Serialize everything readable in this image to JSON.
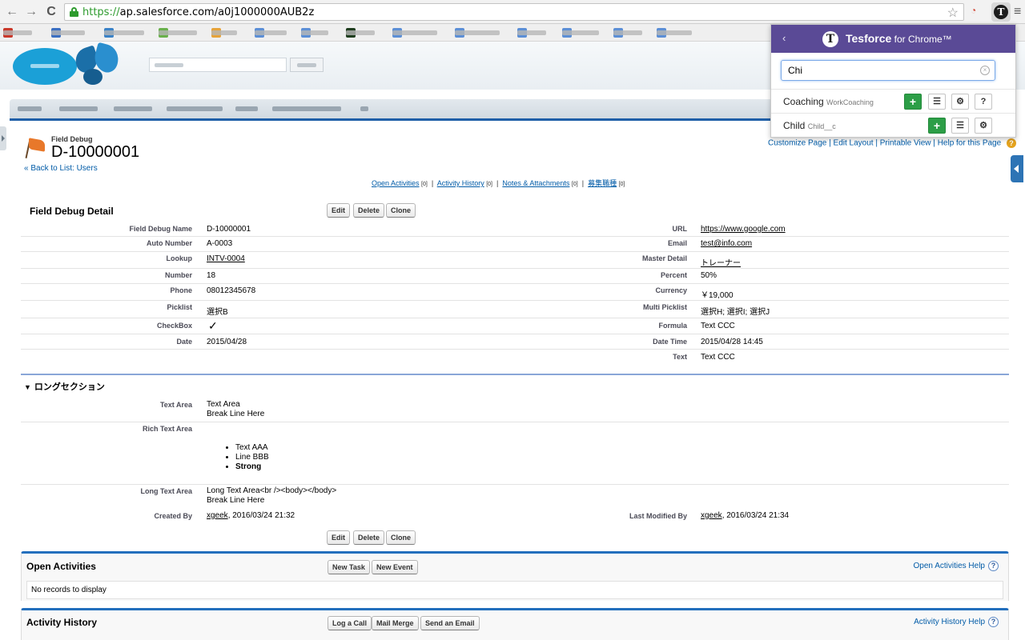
{
  "browser": {
    "url_scheme": "https://",
    "url_rest": "ap.salesforce.com/a0j1000000AUB2z",
    "back": "←",
    "forward": "→",
    "reload": "C",
    "star": "☆",
    "menu": "≡",
    "tesforce_letter": "T"
  },
  "record": {
    "type_label": "Field Debug",
    "name": "D-10000001",
    "back_link": "« Back to List: Users",
    "top_links": [
      "Customize Page",
      "Edit Layout",
      "Printable View",
      "Help for this Page"
    ],
    "help_q": "?"
  },
  "related_links": [
    {
      "label": "Open Activities",
      "count": "[0]"
    },
    {
      "label": "Activity History",
      "count": "[0]"
    },
    {
      "label": "Notes & Attachments",
      "count": "[0]"
    },
    {
      "label": "募集職種",
      "count": "[0]"
    }
  ],
  "detail": {
    "title": "Field Debug Detail",
    "buttons": {
      "edit": "Edit",
      "delete": "Delete",
      "clone": "Clone"
    },
    "left_fields": [
      {
        "label": "Field Debug Name",
        "value": "D-10000001"
      },
      {
        "label": "Auto Number",
        "value": "A-0003"
      },
      {
        "label": "Lookup",
        "value": "INTV-0004"
      },
      {
        "label": "Number",
        "value": "18"
      },
      {
        "label": "Phone",
        "value": "08012345678"
      },
      {
        "label": "Picklist",
        "value": "選択B"
      },
      {
        "label": "CheckBox",
        "value": "✓"
      },
      {
        "label": "Date",
        "value": "2015/04/28"
      }
    ],
    "right_fields": [
      {
        "label": "URL",
        "value": "https://www.google.com"
      },
      {
        "label": "Email",
        "value": "test@info.com"
      },
      {
        "label": "Master Detail",
        "value": "トレーナー"
      },
      {
        "label": "Percent",
        "value": "50%"
      },
      {
        "label": "Currency",
        "value": "￥19,000"
      },
      {
        "label": "Multi Picklist",
        "value": "選択H; 選択I; 選択J"
      },
      {
        "label": "Formula",
        "value": "Text CCC"
      },
      {
        "label": "Date Time",
        "value": "2015/04/28 14:45"
      },
      {
        "label": "Text",
        "value": "Text CCC"
      }
    ]
  },
  "long_section": {
    "title": "ロングセクション",
    "text_area_label": "Text Area",
    "text_area_lines": [
      "Text Area",
      "Break Line Here"
    ],
    "rich_text_label": "Rich Text Area",
    "rich_items": [
      "Text AAA",
      "Line BBB",
      "Strong"
    ],
    "long_text_label": "Long Text Area",
    "long_text_lines": [
      "Long Text Area<br /><body></body>",
      "Break Line Here"
    ],
    "created_by_label": "Created By",
    "created_by_user": "xgeek",
    "created_by_date": ", 2016/03/24 21:32",
    "modified_by_label": "Last Modified By",
    "modified_by_user": "xgeek",
    "modified_by_date": ", 2016/03/24 21:34"
  },
  "open_activities": {
    "title": "Open Activities",
    "btn_task": "New Task",
    "btn_event": "New Event",
    "help": "Open Activities Help",
    "empty": "No records to display"
  },
  "activity_history": {
    "title": "Activity History",
    "btn_call": "Log a Call",
    "btn_merge": "Mail Merge",
    "btn_email": "Send an Email",
    "help": "Activity History Help"
  },
  "popup": {
    "back": "‹",
    "logo": "T",
    "title_bold": "Tesforce",
    "title_rest": " for Chrome™",
    "search_value": "Chi",
    "clear": "×",
    "results": [
      {
        "name": "Coaching",
        "api": "WorkCoaching"
      },
      {
        "name": "Child",
        "api": "Child__c"
      }
    ],
    "btn_add": "+",
    "btn_list": "☰",
    "btn_settings": "⚙",
    "btn_help": "?"
  },
  "colors": {
    "accent": "#1f5fa8",
    "popup_header": "#5a4a96",
    "add_green": "#2c9e47",
    "link": "#015ba7"
  }
}
